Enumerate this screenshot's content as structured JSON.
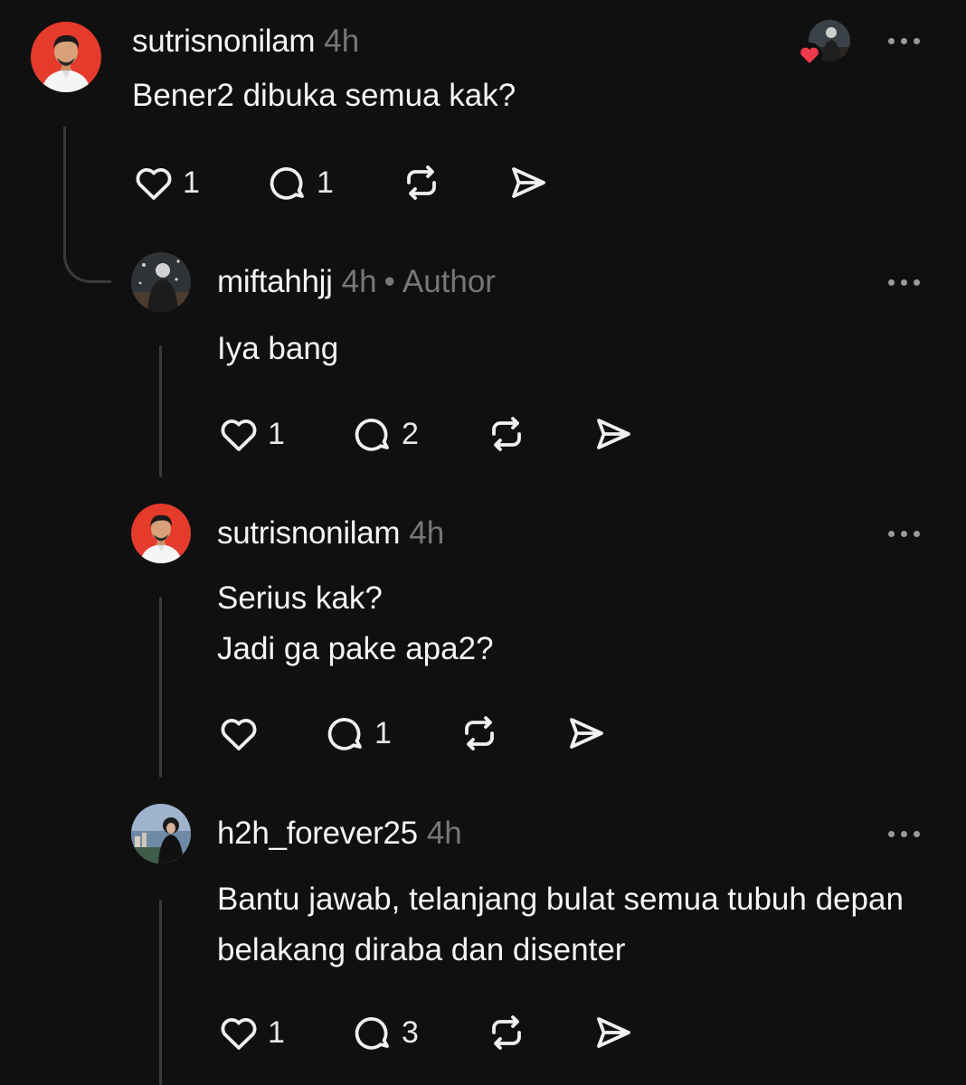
{
  "colors": {
    "background": "#101010",
    "text": "#f3f5f7",
    "muted": "#777777",
    "like_red": "#ee3a4a"
  },
  "icons": {
    "like": "heart-icon",
    "reply": "comment-icon",
    "repost": "repost-icon",
    "share": "send-icon",
    "more": "more-dots-icon"
  },
  "posts": [
    {
      "username": "sutrisnonilam",
      "time": "4h",
      "lines": [
        "Bener2 dibuka semua kak?"
      ],
      "likes": "1",
      "replies": "1",
      "liked_by_author": true
    },
    {
      "username": "miftahhjj",
      "time": "4h",
      "separator": "•",
      "badge": "Author",
      "lines": [
        "Iya bang"
      ],
      "likes": "1",
      "replies": "2"
    },
    {
      "username": "sutrisnonilam",
      "time": "4h",
      "lines": [
        "Serius kak?",
        "Jadi ga pake apa2?"
      ],
      "likes": "",
      "replies": "1"
    },
    {
      "username": "h2h_forever25",
      "time": "4h",
      "lines": [
        "Bantu jawab, telanjang bulat semua tubuh depan",
        "belakang diraba dan disenter"
      ],
      "likes": "1",
      "replies": "3"
    }
  ]
}
